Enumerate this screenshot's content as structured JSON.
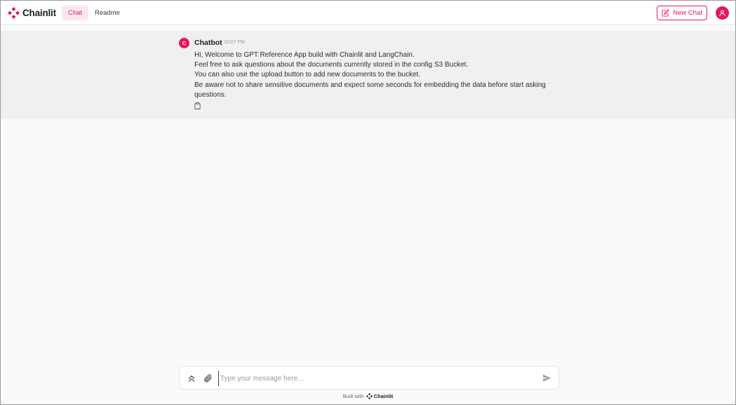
{
  "header": {
    "brand": "Chainlit",
    "tabs": [
      {
        "label": "Chat",
        "active": true
      },
      {
        "label": "Readme",
        "active": false
      }
    ],
    "new_chat_label": "New Chat"
  },
  "message": {
    "author_initial": "C",
    "author": "Chatbot",
    "time": "10:07 PM",
    "lines": [
      "Hi, Welcome to GPT Reference App build with Chainlit and LangChain.",
      "Feel free to ask questions about the documents currently stored in the config S3 Bucket.",
      "You can also use the upload button to add new documents to the bucket.",
      "Be aware not to share sensitive documents and expect some seconds for embedding the data before start asking questions."
    ]
  },
  "input": {
    "placeholder": "Type your message here...",
    "value": ""
  },
  "footer": {
    "built_with": "Built with",
    "brand": "Chainlit"
  },
  "colors": {
    "accent": "#e5185c",
    "band": "#f0f0f0",
    "background": "#fafafa"
  },
  "icons": [
    "chainlit-logo-icon",
    "edit-icon",
    "user-icon",
    "copy-icon",
    "chevrons-up-icon",
    "paperclip-icon",
    "send-icon"
  ]
}
